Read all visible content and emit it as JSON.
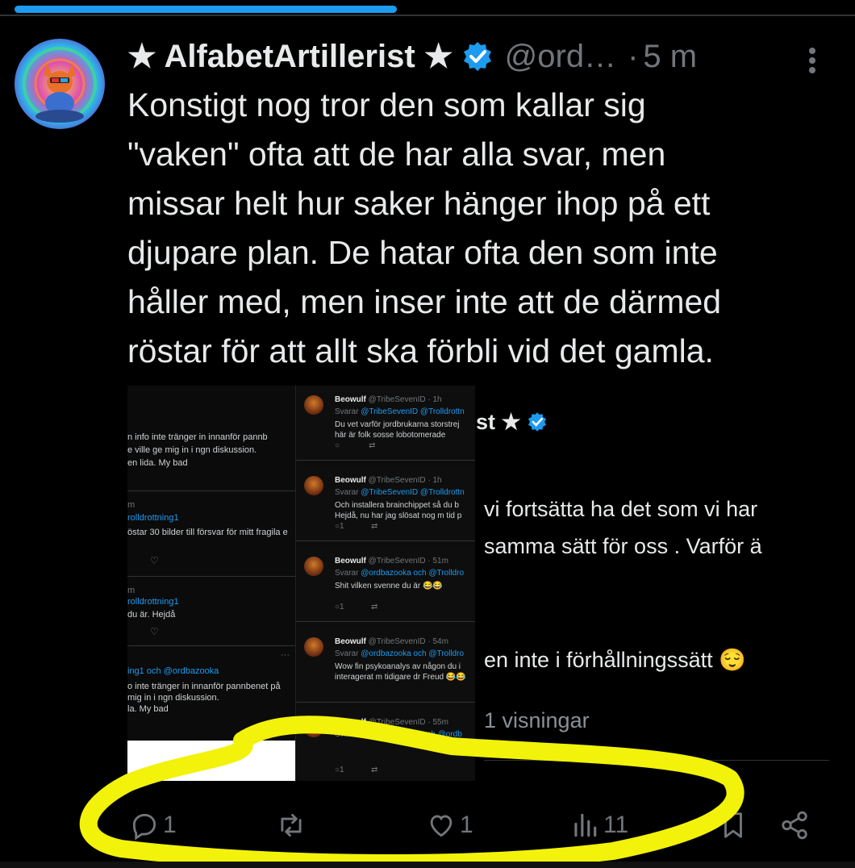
{
  "colors": {
    "accent": "#1d9bf0",
    "muted": "#71767b",
    "text": "#e7e9ea",
    "highlight": "#f2f20a"
  },
  "tweet": {
    "author_name": "★ AlfabetArtillerist ★",
    "handle": "@ord…",
    "separator": "·",
    "time": "5 m",
    "text_lines": [
      "Konstigt nog tror den som kallar sig",
      "\"vaken\" ofta  att de har alla svar, men",
      "missar helt hur saker hänger ihop på ett",
      "djupare plan. De hatar ofta den som inte",
      "håller med,  men inser inte att de därmed",
      "röstar för att allt ska förbli vid det  gamla."
    ]
  },
  "media": {
    "left_panel": {
      "lines": [
        "n info inte tränger in innanför pannb",
        "e ville ge mig in i ngn diskussion.",
        "en lida. My bad"
      ],
      "reply1_meta": "m",
      "reply1_mention": "rolldrottning1",
      "reply1_text": "östar 30 bilder till försvar för mitt fragila e",
      "reply2_meta": "m",
      "reply2_mention": "rolldrottning1",
      "reply2_text": "du är. Hejdå",
      "reply3_mention": "ing1 och @ordbazooka",
      "reply3_lines": [
        "o inte tränger in innanför pannbenet på",
        "mig in i ngn diskussion.",
        "la. My bad"
      ]
    },
    "cards": [
      {
        "name": "Beowulf",
        "meta": "@TribeSevenID · 1h",
        "reply_prefix": "Svarar",
        "reply_to": "@TribeSevenID @Trolldrottn",
        "body": [
          "Du vet varför jordbrukarna storstrej",
          "här är folk sosse lobotomerade"
        ]
      },
      {
        "name": "Beowulf",
        "meta": "@TribeSevenID · 1h",
        "reply_prefix": "Svarar",
        "reply_to": "@TribeSevenID @Trolldrottn",
        "body": [
          "Och installera brainchippet så du b",
          "Hejdå, nu har jag slösat nog m tid p"
        ]
      },
      {
        "name": "Beowulf",
        "meta": "@TribeSevenID · 51m",
        "reply_prefix": "Svarar",
        "reply_to": "@ordbazooka och @Trolldro",
        "body": [
          "Shit  vilken svenne du är 😂😂"
        ]
      },
      {
        "name": "Beowulf",
        "meta": "@TribeSevenID · 54m",
        "reply_prefix": "Svarar",
        "reply_to": "@ordbazooka och @Trolldro",
        "body": [
          "Wow fin psykoanalys av någon du i",
          "interagerat m tidigare dr Freud 😂😂"
        ]
      },
      {
        "name": "Beowulf",
        "meta": "@TribeSevenID · 55m",
        "reply_prefix": "Svarar",
        "reply_to": "@Trolldrottning1 och @ordb",
        "body": []
      }
    ],
    "background": {
      "name_fragment": "st ★",
      "line1": "vi fortsätta ha det som vi har",
      "line2": "samma sätt för oss . Varför ä",
      "line3": "en inte i förhållningssätt 😌",
      "views": "1 visningar"
    }
  },
  "actions": {
    "replies": "1",
    "likes": "1",
    "views": "11"
  }
}
